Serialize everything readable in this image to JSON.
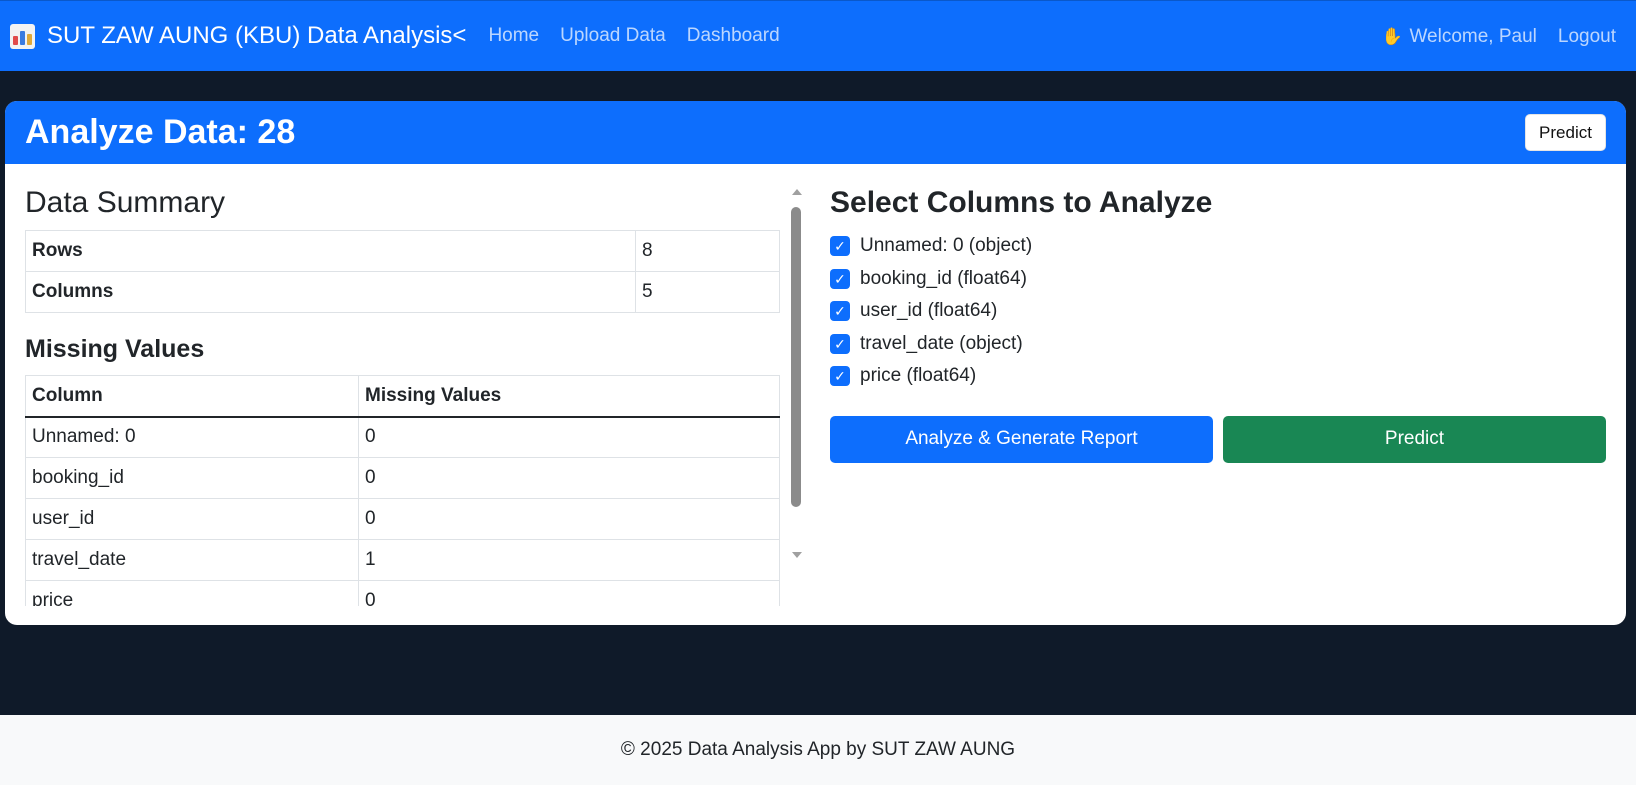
{
  "navbar": {
    "brand": "SUT ZAW AUNG (KBU) Data Analysis<",
    "brand_icon": "bar-chart-icon",
    "links": [
      "Home",
      "Upload Data",
      "Dashboard"
    ],
    "welcome": "Welcome, Paul",
    "welcome_icon": "waving-hand-icon",
    "logout": "Logout"
  },
  "card": {
    "title": "Analyze Data: 28",
    "header_button": "Predict"
  },
  "summary": {
    "title": "Data Summary",
    "rows": [
      {
        "label": "Rows",
        "value": "8"
      },
      {
        "label": "Columns",
        "value": "5"
      }
    ]
  },
  "missing": {
    "title": "Missing Values",
    "headers": [
      "Column",
      "Missing Values"
    ],
    "rows": [
      {
        "column": "Unnamed: 0",
        "missing": "0"
      },
      {
        "column": "booking_id",
        "missing": "0"
      },
      {
        "column": "user_id",
        "missing": "0"
      },
      {
        "column": "travel_date",
        "missing": "1"
      },
      {
        "column": "price",
        "missing": "0"
      }
    ]
  },
  "columns_panel": {
    "title": "Select Columns to Analyze",
    "items": [
      {
        "label": "Unnamed: 0 (object)",
        "checked": true
      },
      {
        "label": "booking_id (float64)",
        "checked": true
      },
      {
        "label": "user_id (float64)",
        "checked": true
      },
      {
        "label": "travel_date (object)",
        "checked": true
      },
      {
        "label": "price (float64)",
        "checked": true
      }
    ],
    "analyze_button": "Analyze & Generate Report",
    "predict_button": "Predict"
  },
  "footer": {
    "text": "© 2025 Data Analysis App by SUT ZAW AUNG"
  },
  "colors": {
    "primary": "#0d6efd",
    "success": "#198754",
    "background": "#0f1a29",
    "footer_bg": "#f8f9fa"
  }
}
